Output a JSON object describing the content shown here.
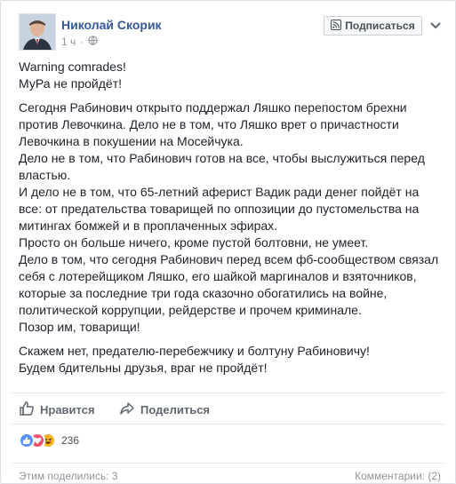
{
  "author": {
    "name": "Николай Скорик",
    "time": "1 ч",
    "subscribe_label": "Подписаться"
  },
  "post": {
    "paragraphs": [
      [
        "Warning comrades!",
        "МуРа не пройдёт!"
      ],
      [
        "Сегодня Рабинович открыто поддержал Ляшко перепостом брехни",
        "против Левочкина. Дело не в том, что Ляшко врет о причастности",
        "Левочкина в покушении на Мосейчука.",
        "Дело не в том, что Рабинович готов на все, чтобы выслужиться перед",
        "властью.",
        "И дело не в том, что 65-летний аферист Вадик ради денег пойдёт на",
        "все: от предательства товарищей по оппозиции до пустомельства на",
        "митингах бомжей и в проплаченных эфирах.",
        "Просто он больше ничего, кроме пустой болтовни, не умеет.",
        "Дело в том, что сегодня Рабинович перед всем фб-сообществом связал",
        "себя с лотерейщиком Ляшко, его шайкой маргиналов и взяточников,",
        "которые за последние три года сказочно обогатились на войне,",
        "политической коррупции, рейдерстве и прочем криминале.",
        "Позор им, товарищи!"
      ],
      [
        "Скажем нет, предателю-перебежчику и болтуну Рабиновичу!",
        "Будем бдительны друзья, враг не пройдёт!"
      ]
    ]
  },
  "actions": {
    "like_label": "Нравится",
    "share_label": "Поделиться"
  },
  "reactions": {
    "types": [
      "like",
      "love",
      "haha"
    ],
    "count": "236"
  },
  "footer": {
    "shares": "Этим поделились: 3",
    "comments": "Комментарии: (2)"
  },
  "colors": {
    "link": "#365899",
    "like": "#5890ff",
    "love": "#f25268",
    "haha": "#f7b125"
  }
}
